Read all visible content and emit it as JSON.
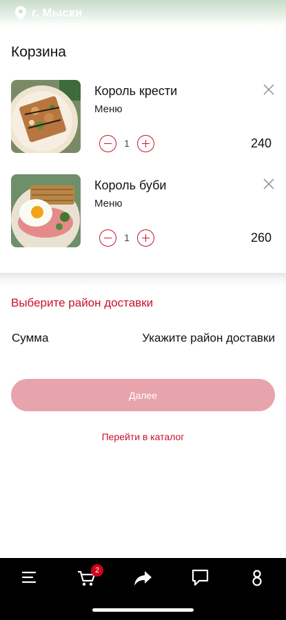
{
  "location": {
    "city": "г. Мыски",
    "icon": "location-pin-icon"
  },
  "page": {
    "title": "Корзина"
  },
  "cart": {
    "items": [
      {
        "name": "Король крести",
        "category": "Меню",
        "quantity": "1",
        "price": "240",
        "image": "waffle-salad-photo"
      },
      {
        "name": "Король буби",
        "category": "Меню",
        "quantity": "1",
        "price": "260",
        "image": "waffle-egg-photo"
      }
    ]
  },
  "delivery": {
    "select_district": "Выберите район доставки"
  },
  "summary": {
    "label": "Сумма",
    "value": "Укажите район доставки"
  },
  "actions": {
    "next_label": "Далее",
    "catalog_link": "Перейти в каталог"
  },
  "nav": {
    "items": [
      "menu-icon",
      "cart-icon",
      "share-icon",
      "chat-icon",
      "profile-icon"
    ],
    "cart_badge": "2"
  },
  "colors": {
    "accent": "#c8102e",
    "button_disabled": "#e8a4ac",
    "nav_bg": "#000000",
    "badge": "#d0021b"
  }
}
